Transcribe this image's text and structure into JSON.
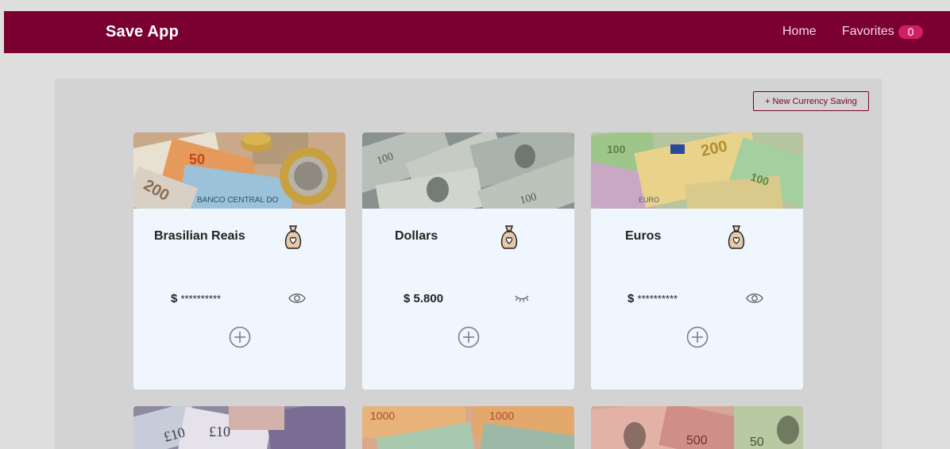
{
  "navbar": {
    "brand": "Save App",
    "home_label": "Home",
    "favorites_label": "Favorites",
    "favorites_count": "0"
  },
  "actions": {
    "new_saving_label": "+ New Currency Saving"
  },
  "cards": [
    {
      "title": "Brasilian Reais",
      "currency_symbol": "$",
      "amount": "**********",
      "amount_visible": false,
      "visibility_icon": "eye-icon",
      "image": "brazilian-banknotes-and-coins"
    },
    {
      "title": "Dollars",
      "currency_symbol": "$",
      "amount": "5.800",
      "amount_visible": true,
      "visibility_icon": "eye-closed-icon",
      "image": "us-dollar-bills"
    },
    {
      "title": "Euros",
      "currency_symbol": "$",
      "amount": "**********",
      "amount_visible": false,
      "visibility_icon": "eye-icon",
      "image": "euro-banknotes"
    }
  ],
  "more_cards": [
    {
      "image": "pound-sterling-banknotes"
    },
    {
      "image": "argentine-peso-banknotes"
    },
    {
      "image": "thai-baht-banknotes"
    }
  ],
  "icons": {
    "bag": "money-bag-icon",
    "add": "add-circle-icon"
  },
  "colors": {
    "navbar": "#79002f",
    "badge": "#d21e63",
    "page_bg": "#dedede",
    "container_bg": "#d3d3d3",
    "card_bg": "#eff6fe",
    "accent": "#79002f"
  }
}
